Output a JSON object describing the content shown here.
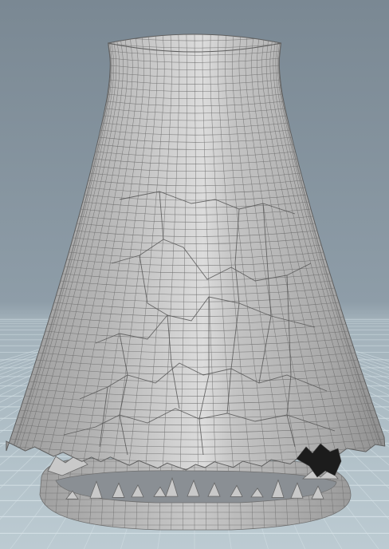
{
  "viewport": {
    "background_top_color": "#7c8994",
    "background_mid_color": "#93a2ad",
    "floor_near_color": "#b9c8cf",
    "grid_line_color": "#d5e1e6",
    "model_color": "#b8b8b8",
    "wire_color": "#6e6e6e",
    "crack_color": "#555555"
  },
  "model": {
    "object_name": "cooling-tower",
    "state": "fractured"
  }
}
